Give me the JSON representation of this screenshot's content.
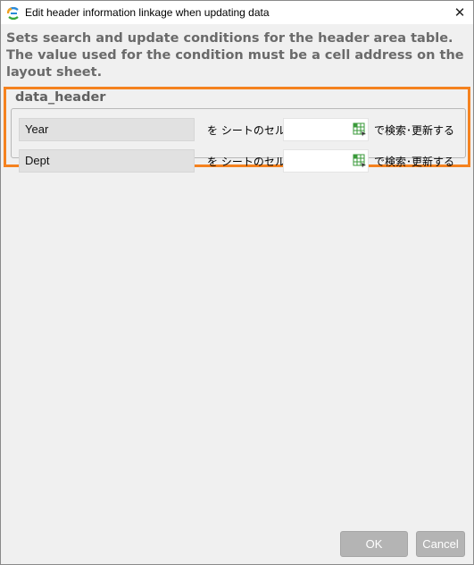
{
  "window": {
    "title": "Edit header information linkage when updating data",
    "close_glyph": "✕"
  },
  "description": "Sets search and update conditions for the header area table. The value used for the condition must be a cell address on the layout sheet.",
  "group": {
    "title": "data_header",
    "rows": [
      {
        "field": "Year",
        "connector": "を シートのセル",
        "cell_value": "",
        "suffix": "で検索･更新する"
      },
      {
        "field": "Dept",
        "connector": "を シートのセル",
        "cell_value": "",
        "suffix": "で検索･更新する"
      }
    ]
  },
  "buttons": {
    "ok": "OK",
    "cancel": "Cancel"
  },
  "colors": {
    "highlight": "#f5821f",
    "button_bg": "#b4b4b4",
    "grid_icon": "#3a9a3a"
  },
  "icons": {
    "app": "app-logo-icon",
    "close": "close-icon",
    "cell_picker": "grid-select-icon"
  }
}
